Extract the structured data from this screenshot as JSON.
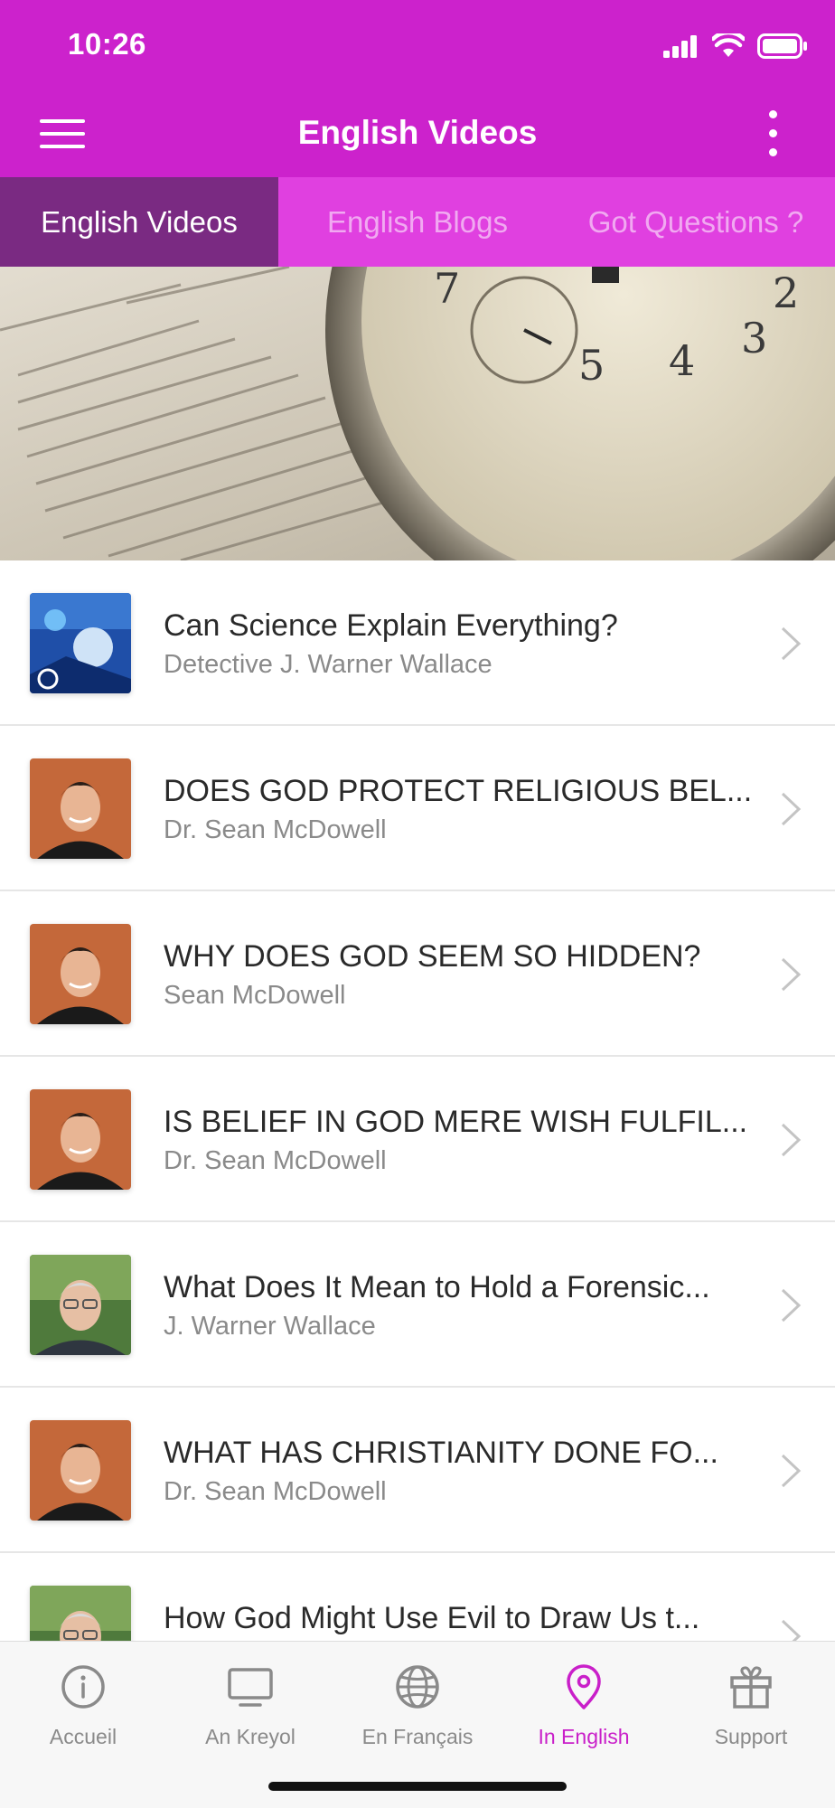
{
  "status_bar": {
    "time": "10:26"
  },
  "app_bar": {
    "title": "English Videos"
  },
  "tabs": [
    {
      "label": "English Videos",
      "active": true
    },
    {
      "label": "English Blogs",
      "active": false
    },
    {
      "label": "Got Questions ?",
      "active": false
    }
  ],
  "videos": [
    {
      "title": "Can Science Explain Everything?",
      "author": "Detective J. Warner Wallace",
      "thumb": "science-thumbnail"
    },
    {
      "title": "DOES GOD PROTECT RELIGIOUS BEL...",
      "author": "Dr. Sean McDowell",
      "thumb": "sean-mcdowell-photo"
    },
    {
      "title": "WHY DOES GOD SEEM SO HIDDEN?",
      "author": "Sean McDowell",
      "thumb": "sean-mcdowell-photo"
    },
    {
      "title": "IS BELIEF IN GOD MERE WISH FULFIL...",
      "author": "Dr. Sean McDowell",
      "thumb": "sean-mcdowell-photo"
    },
    {
      "title": "What Does It Mean to Hold a Forensic...",
      "author": "J. Warner Wallace",
      "thumb": "warner-wallace-photo"
    },
    {
      "title": "WHAT HAS CHRISTIANITY DONE FO...",
      "author": "Dr. Sean McDowell",
      "thumb": "sean-mcdowell-photo"
    },
    {
      "title": "How God Might Use Evil to Draw Us t...",
      "author": "",
      "thumb": "warner-wallace-photo"
    }
  ],
  "bottom_nav": [
    {
      "label": "Accueil",
      "icon": "info-circle-icon",
      "active": false
    },
    {
      "label": "An Kreyol",
      "icon": "monitor-icon",
      "active": false
    },
    {
      "label": "En Français",
      "icon": "globe-icon",
      "active": false
    },
    {
      "label": "In English",
      "icon": "location-pin-icon",
      "active": true
    },
    {
      "label": "Support",
      "icon": "gift-icon",
      "active": false
    }
  ],
  "colors": {
    "header": "#cc22cc",
    "tab_bar": "#e040e0",
    "tab_active": "#7a2a82",
    "nav_active": "#c91fc9"
  }
}
